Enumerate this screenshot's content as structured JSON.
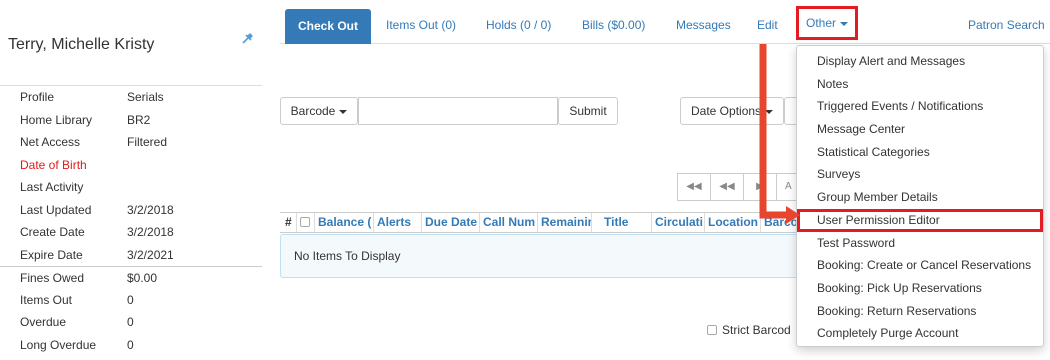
{
  "patron": {
    "name": "Terry, Michelle Kristy",
    "pin_icon": "pin-icon",
    "summary": [
      {
        "label": "Profile",
        "value": "Serials"
      },
      {
        "label": "Home Library",
        "value": "BR2"
      },
      {
        "label": "Net Access",
        "value": "Filtered"
      },
      {
        "label": "Date of Birth",
        "value": ""
      },
      {
        "label": "Last Activity",
        "value": ""
      },
      {
        "label": "Last Updated",
        "value": "3/2/2018"
      },
      {
        "label": "Create Date",
        "value": "3/2/2018"
      },
      {
        "label": "Expire Date",
        "value": "3/2/2021"
      },
      {
        "label": "Fines Owed",
        "value": "$0.00"
      },
      {
        "label": "Items Out",
        "value": "0"
      },
      {
        "label": "Overdue",
        "value": "0"
      },
      {
        "label": "Long Overdue",
        "value": "0"
      }
    ]
  },
  "nav": {
    "tabs": [
      {
        "label": "Check Out"
      },
      {
        "label": "Items Out (0)"
      },
      {
        "label": "Holds (0 / 0)"
      },
      {
        "label": "Bills ($0.00)"
      },
      {
        "label": "Messages"
      },
      {
        "label": "Edit"
      },
      {
        "label": "Other"
      },
      {
        "label": "Patron Search"
      }
    ]
  },
  "checkout": {
    "barcode_type": "Barcode",
    "barcode_value": "",
    "submit_label": "Submit",
    "date_options_label": "Date Options"
  },
  "pager": {
    "first_icon": "first-page-icon",
    "prev_icon": "previous-page-icon",
    "next_icon": "next-page-icon",
    "partial_text": "A"
  },
  "grid": {
    "columns": [
      "#",
      "",
      "Balance (",
      "Alerts",
      "Due Date",
      "Call Num",
      "Remainir",
      "Title",
      "Circulati",
      "Location",
      "Barco"
    ],
    "empty_message": "No Items To Display"
  },
  "footer": {
    "strict_barcode": "Strict Barcod"
  },
  "menu": {
    "items": [
      {
        "label": "Display Alert and Messages"
      },
      {
        "label": "Notes"
      },
      {
        "label": "Triggered Events / Notifications"
      },
      {
        "label": "Message Center"
      },
      {
        "label": "Statistical Categories"
      },
      {
        "label": "Surveys"
      },
      {
        "label": "Group Member Details"
      },
      {
        "label": "User Permission Editor"
      },
      {
        "label": "Test Password"
      },
      {
        "label": "Booking: Create or Cancel Reservations"
      },
      {
        "label": "Booking: Pick Up Reservations"
      },
      {
        "label": "Booking: Return Reservations"
      },
      {
        "label": "Completely Purge Account"
      }
    ]
  },
  "colors": {
    "accent": "#337ab7",
    "annotation": "#e31b23",
    "alert_label": "#e01b1b",
    "empty_bg": "#f4f9fc"
  }
}
